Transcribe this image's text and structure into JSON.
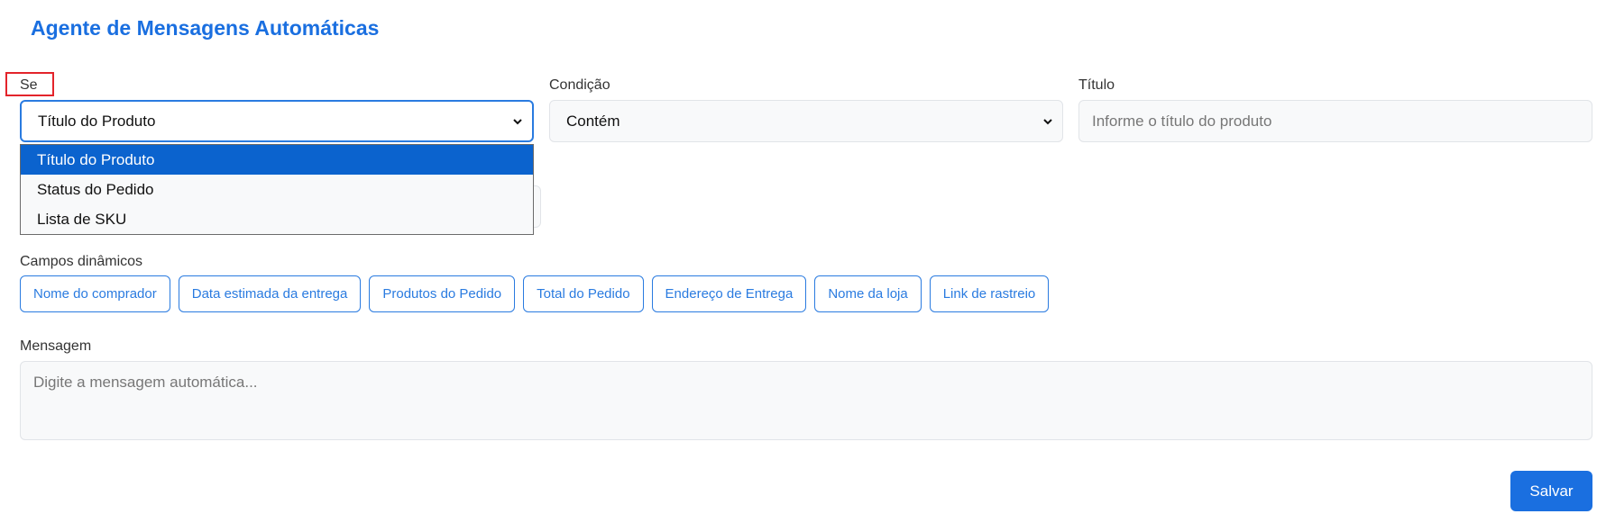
{
  "header": {
    "title": "Agente de Mensagens Automáticas"
  },
  "rule": {
    "if_label": "Se",
    "if_value": "Título do Produto",
    "condition_label": "Condição",
    "condition_value": "Contém",
    "title_label": "Título",
    "title_placeholder": "Informe o título do produto",
    "dropdown_options": [
      "Título do Produto",
      "Status do Pedido",
      "Lista de SKU"
    ],
    "dropdown_selected_index": 0
  },
  "dynamic_fields": {
    "label": "Campos dinâmicos",
    "chips": [
      "Nome do comprador",
      "Data estimada da entrega",
      "Produtos do Pedido",
      "Total do Pedido",
      "Endereço de Entrega",
      "Nome da loja",
      "Link de rastreio"
    ]
  },
  "message": {
    "label": "Mensagem",
    "placeholder": "Digite a mensagem automática..."
  },
  "actions": {
    "save_label": "Salvar"
  },
  "colors": {
    "accent": "#1a6fe0",
    "dropdown_selected": "#0b63ce",
    "highlight": "#e3242b"
  },
  "icons": {
    "select_chevron": "chevron-down-icon"
  }
}
